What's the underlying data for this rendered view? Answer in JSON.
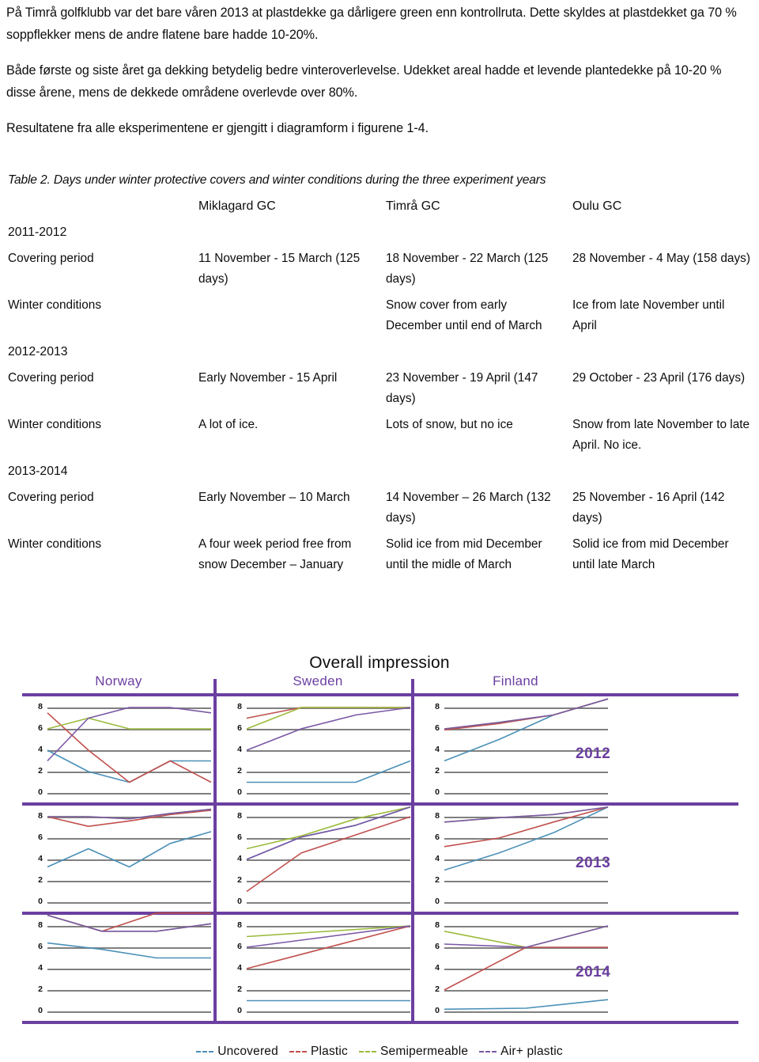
{
  "prose": {
    "paragraphs": [
      "På Timrå golfklubb var det bare våren 2013 at plastdekke ga dårligere green enn kontrollruta. Dette skyldes at plastdekket ga 70 % soppflekker mens de andre flatene bare hadde 10-20%.",
      "Både første og siste året ga dekking betydelig bedre vinteroverlevelse. Udekket areal hadde et levende plantedekke på 10-20 % disse årene, mens de dekkede områdene overlevde over 80%.",
      "Resultatene fra alle eksperimentene er gjengitt i diagramform i figurene 1-4."
    ]
  },
  "table": {
    "caption": "Table 2. Days under winter protective covers  and winter conditions during the three experiment years",
    "columns": [
      "",
      "Miklagard GC",
      "Timrå GC",
      "Oulu GC"
    ],
    "groups": [
      {
        "year": "2011-2012",
        "rows": [
          {
            "label": "Covering period",
            "cells": [
              "11 November - 15 March (125 days)",
              "18 November - 22 March (125 days)",
              "28 November - 4 May (158 days)"
            ]
          },
          {
            "label": "Winter conditions",
            "cells": [
              "",
              "Snow cover from early December until end of March",
              "Ice from late November until April"
            ]
          }
        ]
      },
      {
        "year": "2012-2013",
        "rows": [
          {
            "label": "Covering period",
            "cells": [
              "Early November - 15 April",
              "23 November - 19 April (147 days)",
              "29 October - 23 April (176 days)"
            ]
          },
          {
            "label": "Winter conditions",
            "cells": [
              "A lot of ice.",
              "Lots of snow, but no ice",
              "Snow from late November to late April. No ice."
            ]
          }
        ]
      },
      {
        "year": "2013-2014",
        "rows": [
          {
            "label": "Covering period",
            "cells": [
              "Early November – 10 March",
              "14 November – 26 March (132 days)",
              "25 November - 16 April (142 days)"
            ]
          },
          {
            "label": "Winter conditions",
            "cells": [
              "A four week period free from snow December – January",
              "Solid ice from mid December until the midle of March",
              "Solid ice from mid December until late March"
            ]
          }
        ]
      }
    ]
  },
  "figure": {
    "title": "Overall impression",
    "column_titles": [
      "Norway",
      "Sweden",
      "Finland"
    ],
    "row_labels": [
      "2012",
      "2013",
      "2014"
    ],
    "legend": [
      {
        "label": "Uncovered",
        "color": "#4a90b8"
      },
      {
        "label": "Plastic",
        "color": "#c0504d"
      },
      {
        "label": "Semipermeable",
        "color": "#9bbb3c"
      },
      {
        "label": "Air+ plastic",
        "color": "#7a57a5"
      }
    ]
  },
  "chart_data": [
    {
      "type": "line",
      "title": "Overall impression",
      "panel": "Norway 2012",
      "country": "Norway",
      "year": "2012",
      "x": [
        1,
        2,
        3,
        4,
        5
      ],
      "ylim": [
        0,
        9
      ],
      "yticks": [
        0,
        2,
        4,
        6,
        8
      ],
      "grid": true,
      "series": [
        {
          "name": "Uncovered",
          "values": [
            4.0,
            2.0,
            1.0,
            3.0,
            3.0
          ]
        },
        {
          "name": "Plastic",
          "values": [
            7.5,
            4.0,
            1.0,
            3.0,
            1.0
          ]
        },
        {
          "name": "Semipermeable",
          "values": [
            6.0,
            7.0,
            6.0,
            6.0,
            6.0
          ]
        },
        {
          "name": "Air+ plastic",
          "values": [
            3.0,
            7.0,
            8.0,
            8.0,
            7.5
          ]
        }
      ]
    },
    {
      "type": "line",
      "title": "Overall impression",
      "panel": "Sweden 2012",
      "country": "Sweden",
      "year": "2012",
      "x": [
        1,
        2,
        3,
        4
      ],
      "ylim": [
        0,
        9
      ],
      "yticks": [
        0,
        2,
        4,
        6,
        8
      ],
      "grid": true,
      "series": [
        {
          "name": "Uncovered",
          "values": [
            1.0,
            1.0,
            1.0,
            3.0
          ]
        },
        {
          "name": "Plastic",
          "values": [
            7.0,
            8.0,
            8.0,
            8.0
          ]
        },
        {
          "name": "Semipermeable",
          "values": [
            6.0,
            8.0,
            8.0,
            8.0
          ]
        },
        {
          "name": "Air+ plastic",
          "values": [
            4.0,
            6.0,
            7.3,
            8.0
          ]
        }
      ]
    },
    {
      "type": "line",
      "title": "Overall impression",
      "panel": "Finland 2012",
      "country": "Finland",
      "year": "2012",
      "x": [
        1,
        2,
        3,
        4
      ],
      "ylim": [
        0,
        9
      ],
      "yticks": [
        0,
        2,
        4,
        6,
        8
      ],
      "grid": true,
      "series": [
        {
          "name": "Uncovered",
          "values": [
            3.0,
            5.0,
            7.3,
            8.8
          ]
        },
        {
          "name": "Plastic",
          "values": [
            5.9,
            6.5,
            7.3,
            8.8
          ]
        },
        {
          "name": "Semipermeable",
          "values": [
            6.0,
            6.6,
            7.3,
            8.8
          ]
        },
        {
          "name": "Air+ plastic",
          "values": [
            6.0,
            6.6,
            7.3,
            8.8
          ]
        }
      ]
    },
    {
      "type": "line",
      "title": "Overall impression",
      "panel": "Norway 2013",
      "country": "Norway",
      "year": "2013",
      "x": [
        1,
        2,
        3,
        4,
        5
      ],
      "ylim": [
        0,
        9
      ],
      "yticks": [
        0,
        2,
        4,
        6,
        8
      ],
      "grid": true,
      "series": [
        {
          "name": "Uncovered",
          "values": [
            3.3,
            5.0,
            3.3,
            5.5,
            6.6
          ]
        },
        {
          "name": "Plastic",
          "values": [
            8.0,
            7.1,
            7.6,
            8.2,
            8.6
          ]
        },
        {
          "name": "Semipermeable",
          "values": [
            8.0,
            8.0,
            7.8,
            8.3,
            8.7
          ]
        },
        {
          "name": "Air+ plastic",
          "values": [
            8.0,
            8.0,
            7.8,
            8.3,
            8.7
          ]
        }
      ]
    },
    {
      "type": "line",
      "title": "Overall impression",
      "panel": "Sweden 2013",
      "country": "Sweden",
      "year": "2013",
      "x": [
        1,
        2,
        3,
        4
      ],
      "ylim": [
        0,
        9
      ],
      "yticks": [
        0,
        2,
        4,
        6,
        8
      ],
      "grid": true,
      "series": [
        {
          "name": "Uncovered",
          "values": [
            4.0,
            6.1,
            7.2,
            8.9
          ]
        },
        {
          "name": "Plastic",
          "values": [
            1.0,
            4.6,
            6.3,
            8.0
          ]
        },
        {
          "name": "Semipermeable",
          "values": [
            5.0,
            6.2,
            7.8,
            8.9
          ]
        },
        {
          "name": "Air+ plastic",
          "values": [
            4.0,
            6.1,
            7.2,
            8.9
          ]
        }
      ]
    },
    {
      "type": "line",
      "title": "Overall impression",
      "panel": "Finland 2013",
      "country": "Finland",
      "year": "2013",
      "x": [
        1,
        2,
        3,
        4
      ],
      "ylim": [
        0,
        9
      ],
      "yticks": [
        0,
        2,
        4,
        6,
        8
      ],
      "grid": true,
      "series": [
        {
          "name": "Uncovered",
          "values": [
            3.0,
            4.6,
            6.5,
            8.9
          ]
        },
        {
          "name": "Plastic",
          "values": [
            5.2,
            6.0,
            7.5,
            8.9
          ]
        },
        {
          "name": "Semipermeable",
          "values": [
            7.5,
            7.9,
            8.2,
            8.9
          ]
        },
        {
          "name": "Air+ plastic",
          "values": [
            7.5,
            7.9,
            8.2,
            8.9
          ]
        }
      ]
    },
    {
      "type": "line",
      "title": "Overall impression",
      "panel": "Norway 2014",
      "country": "Norway",
      "year": "2014",
      "x": [
        1,
        2,
        3,
        4
      ],
      "ylim": [
        0,
        9
      ],
      "yticks": [
        0,
        2,
        4,
        6,
        8
      ],
      "grid": true,
      "series": [
        {
          "name": "Uncovered",
          "values": [
            6.4,
            5.8,
            5.0,
            5.0
          ]
        },
        {
          "name": "Plastic",
          "values": [
            9.0,
            7.5,
            9.2,
            9.2
          ]
        },
        {
          "name": "Semipermeable",
          "values": [
            9.0,
            7.5,
            7.5,
            8.2
          ]
        },
        {
          "name": "Air+ plastic",
          "values": [
            9.0,
            7.5,
            7.5,
            8.2
          ]
        }
      ]
    },
    {
      "type": "line",
      "title": "Overall impression",
      "panel": "Sweden 2014",
      "country": "Sweden",
      "year": "2014",
      "x": [
        1,
        2
      ],
      "ylim": [
        0,
        9
      ],
      "yticks": [
        0,
        2,
        4,
        6,
        8
      ],
      "grid": true,
      "series": [
        {
          "name": "Uncovered",
          "values": [
            1.0,
            1.0
          ]
        },
        {
          "name": "Plastic",
          "values": [
            4.0,
            8.0
          ]
        },
        {
          "name": "Semipermeable",
          "values": [
            7.0,
            8.0
          ]
        },
        {
          "name": "Air+ plastic",
          "values": [
            6.0,
            8.0
          ]
        }
      ]
    },
    {
      "type": "line",
      "title": "Overall impression",
      "panel": "Finland 2014",
      "country": "Finland",
      "year": "2014",
      "x": [
        1,
        2,
        3
      ],
      "ylim": [
        0,
        9
      ],
      "yticks": [
        0,
        2,
        4,
        6,
        8
      ],
      "grid": true,
      "series": [
        {
          "name": "Uncovered",
          "values": [
            0.2,
            0.3,
            1.1
          ]
        },
        {
          "name": "Plastic",
          "values": [
            2.0,
            6.0,
            6.0
          ]
        },
        {
          "name": "Semipermeable",
          "values": [
            7.5,
            6.0,
            8.0
          ]
        },
        {
          "name": "Air+ plastic",
          "values": [
            6.3,
            6.0,
            8.0
          ]
        }
      ]
    }
  ]
}
